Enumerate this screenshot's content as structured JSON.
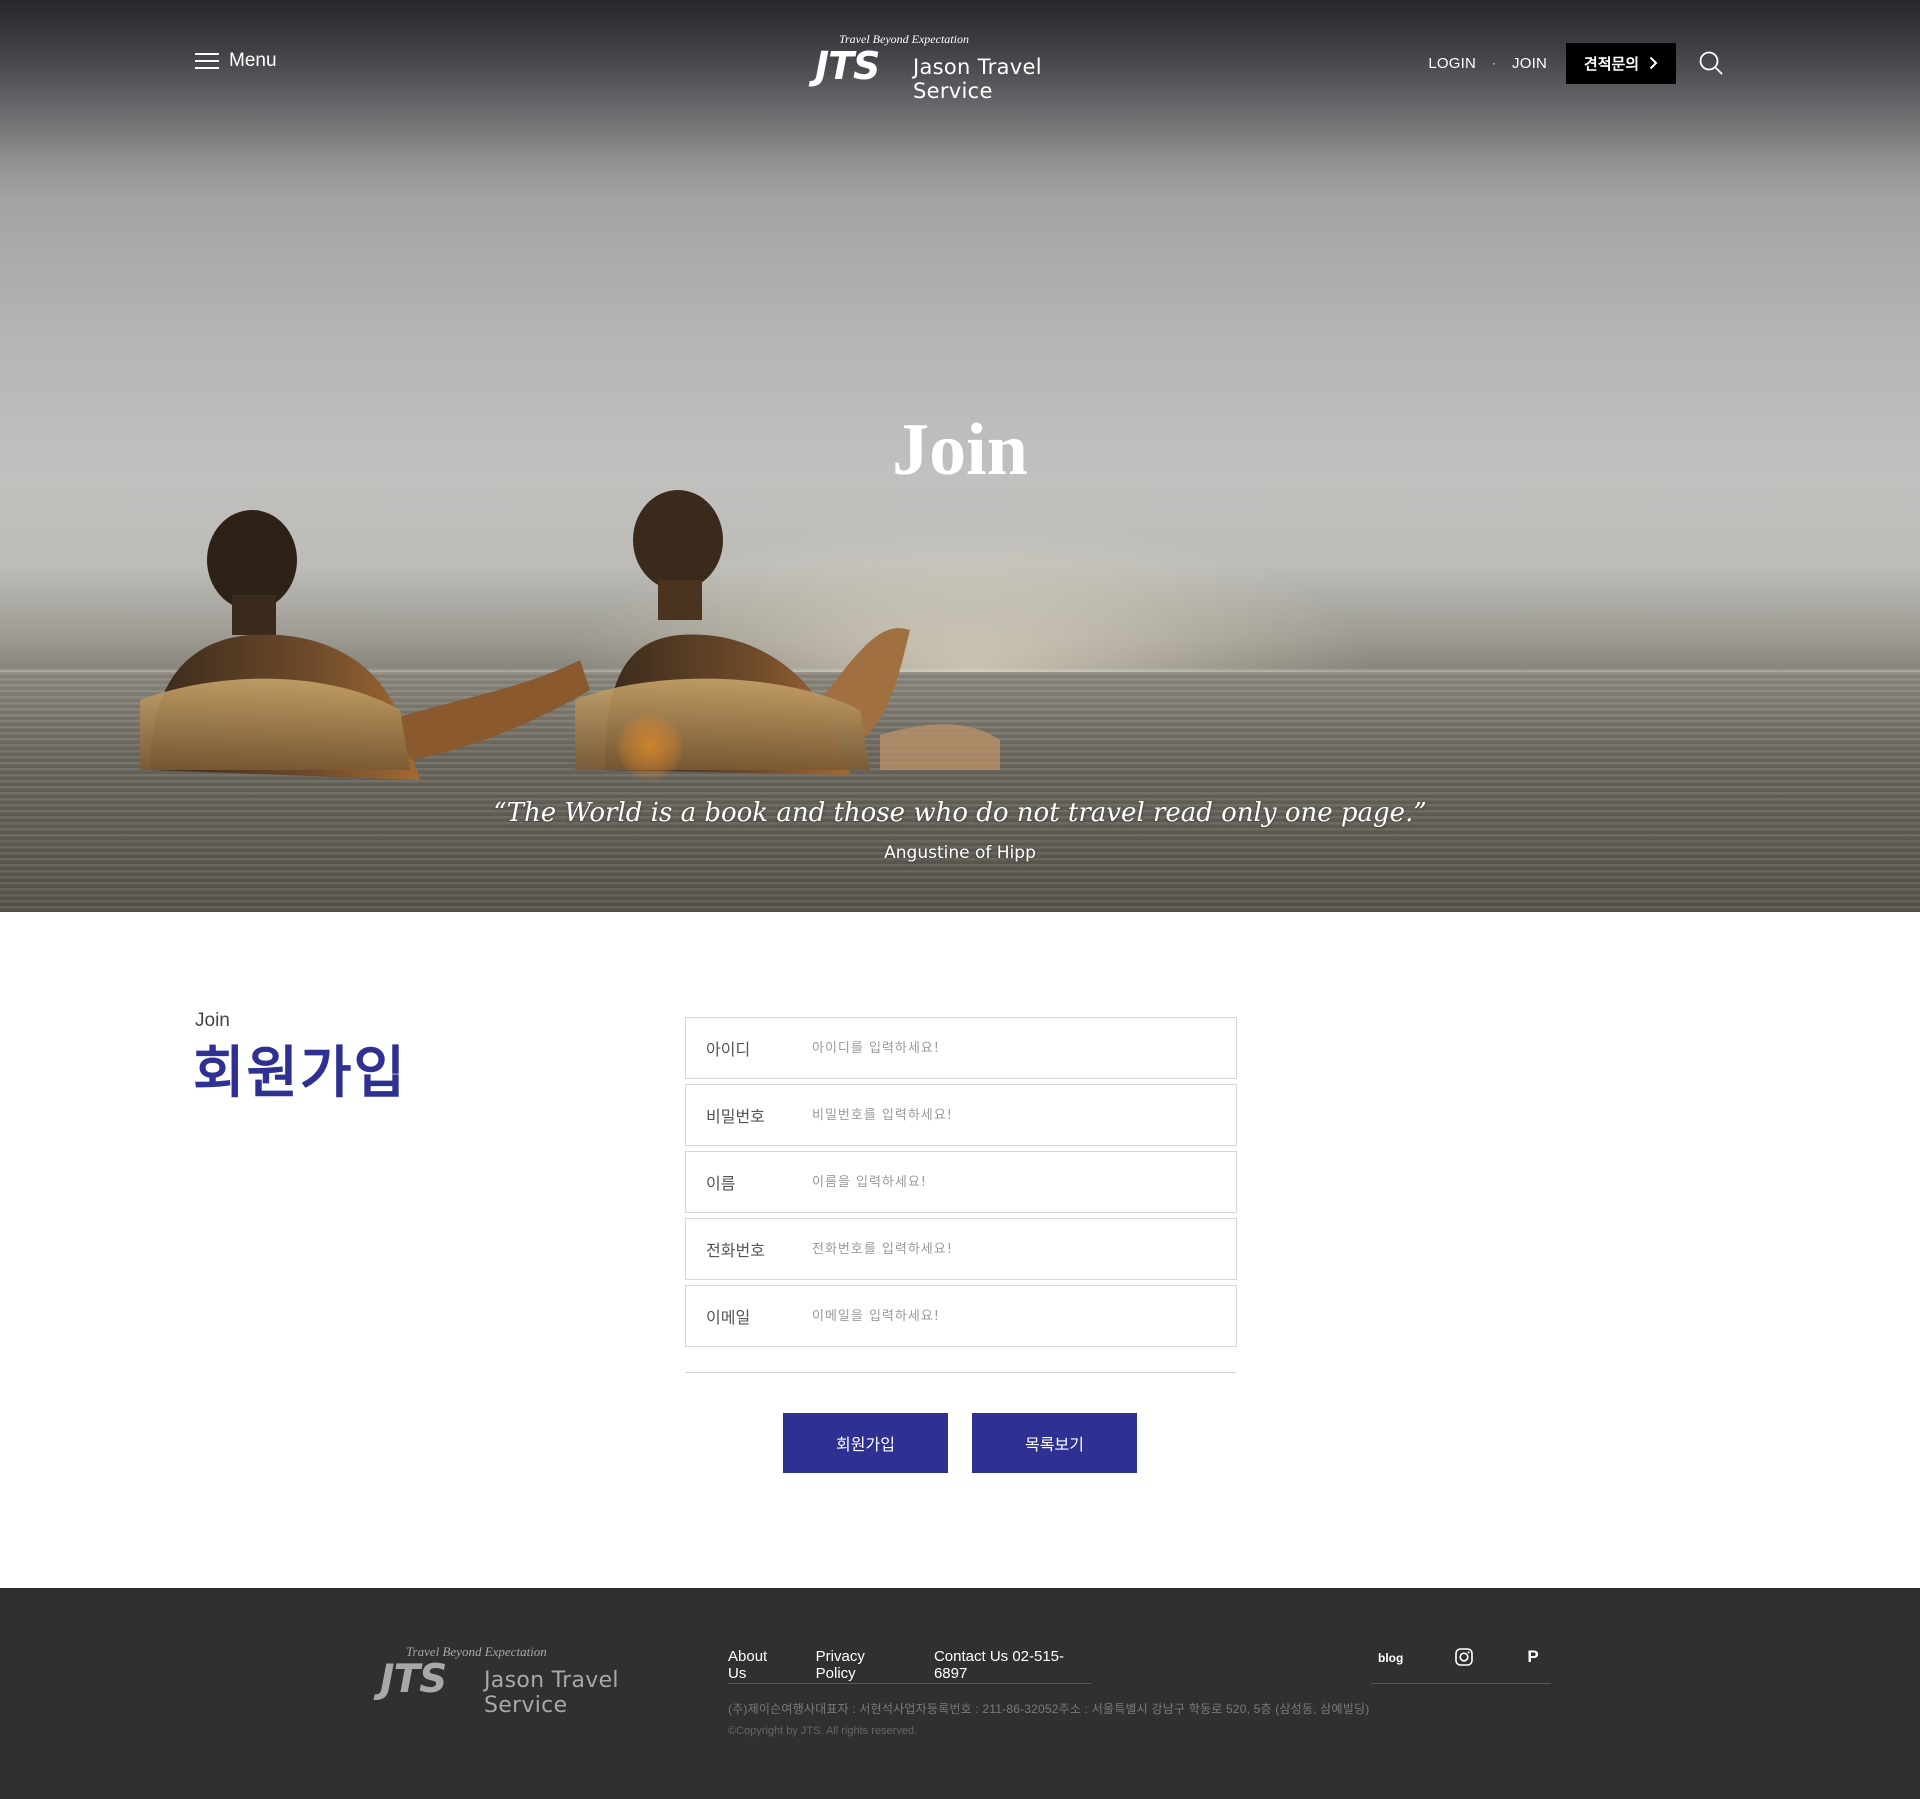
{
  "header": {
    "menu_label": "Menu",
    "logo": {
      "tagline": "Travel Beyond Expectation",
      "mark": "JTS",
      "name": "Jason Travel Service"
    },
    "nav": {
      "login": "LOGIN",
      "separator": "·",
      "join": "JOIN",
      "quote_button": "견적문의"
    }
  },
  "hero": {
    "title": "Join",
    "quote": "“The World is a book and those who do not travel read only one page.”",
    "author": "Angustine of Hipp"
  },
  "section": {
    "label": "Join",
    "title": "회원가입"
  },
  "form": {
    "fields": [
      {
        "label": "아이디",
        "placeholder": "아이디를 입력하세요!",
        "value": ""
      },
      {
        "label": "비밀번호",
        "placeholder": "비밀번호를 입력하세요!",
        "value": ""
      },
      {
        "label": "이름",
        "placeholder": "이름을 입력하세요!",
        "value": ""
      },
      {
        "label": "전화번호",
        "placeholder": "전화번호를 입력하세요!",
        "value": ""
      },
      {
        "label": "이메일",
        "placeholder": "이메일을 입력하세요!",
        "value": ""
      }
    ],
    "submit_label": "회원가입",
    "list_label": "목록보기"
  },
  "footer": {
    "logo": {
      "tagline": "Travel Beyond Expectation",
      "mark": "JTS",
      "name": "Jason Travel Service"
    },
    "links": {
      "about": "About Us",
      "privacy": "Privacy Policy",
      "contact": "Contact Us 02-515-6897"
    },
    "social": {
      "blog": "blog",
      "post": "P"
    },
    "info": "(주)제이슨여행사대표자 : 서현석사업자등록번호 : 211-86-32052주소 : 서울특별시 강남구 학동로 520, 5층 (삼성동, 삼예빌딩)",
    "copyright": "©Copyright by JTS. All rights reserved."
  },
  "colors": {
    "brand": "#2e3192",
    "footer_bg": "#303030",
    "quote_button_bg": "#000000"
  },
  "icons": [
    "hamburger-icon",
    "chevron-right-icon",
    "search-icon",
    "instagram-icon"
  ]
}
